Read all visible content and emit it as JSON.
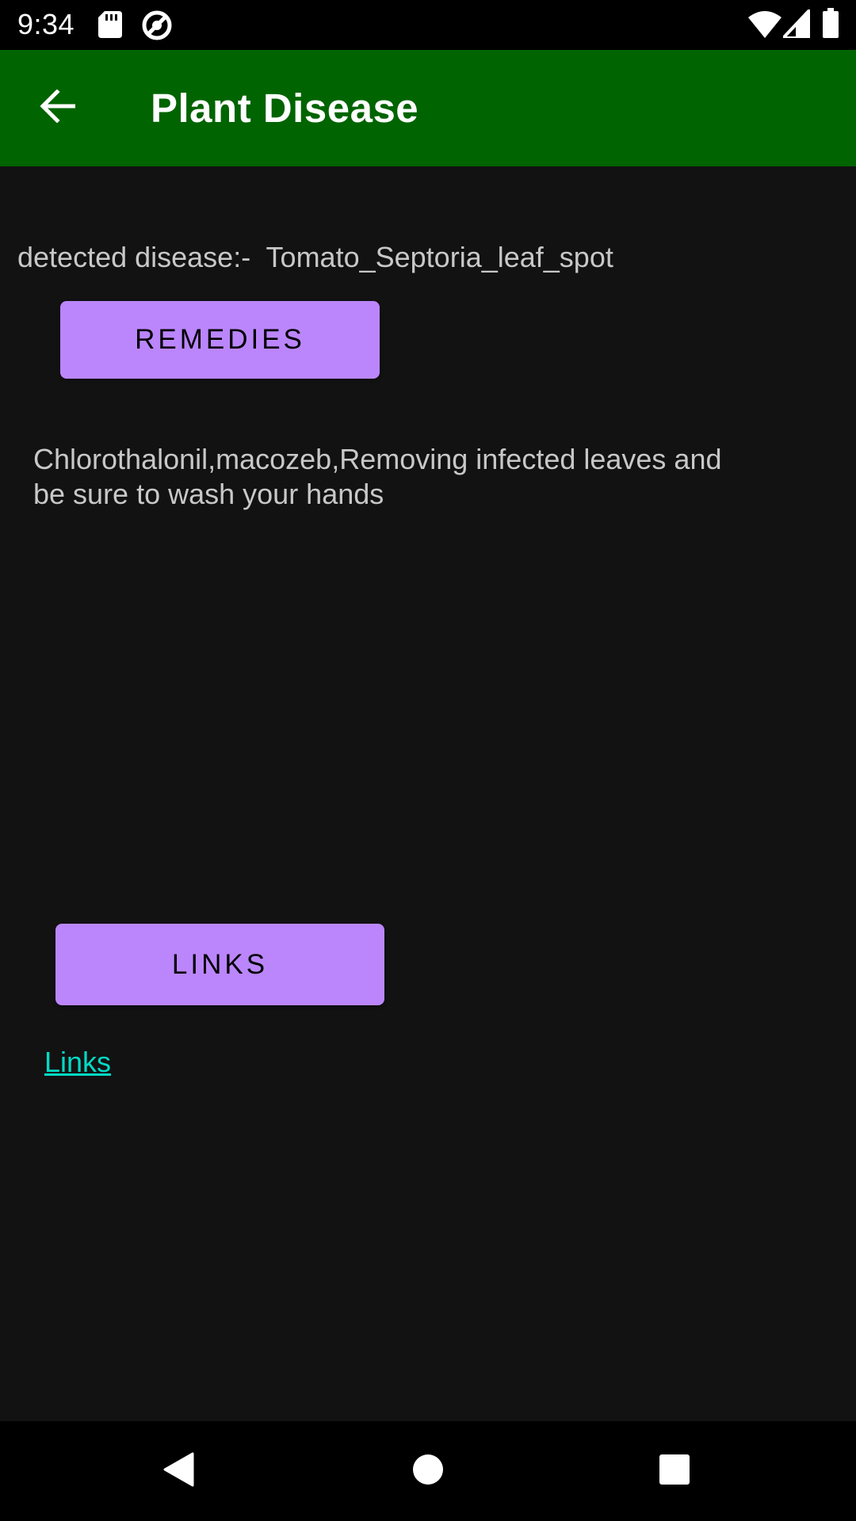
{
  "status_bar": {
    "time": "9:34",
    "icons": [
      "sd-card-icon",
      "vpn-key-icon",
      "wifi-icon",
      "cellular-signal-icon",
      "battery-icon"
    ]
  },
  "app_bar": {
    "title": "Plant Disease",
    "back_icon": "arrow-back-icon",
    "background_color": "#006400"
  },
  "content": {
    "detected_label": "detected disease:-",
    "detected_value": "Tomato_Septoria_leaf_spot",
    "remedies_button": "REMEDIES",
    "remedy_text": "Chlorothalonil,macozeb,Removing infected leaves and be sure to wash your hands",
    "links_button": "LINKS",
    "links_text": "Links"
  },
  "nav_bar": {
    "icons": [
      "back-triangle-icon",
      "home-circle-icon",
      "recents-square-icon"
    ]
  },
  "colors": {
    "background": "#121212",
    "button": "#bb86fc",
    "link": "#03dac5",
    "text": "#c8c8c8"
  }
}
